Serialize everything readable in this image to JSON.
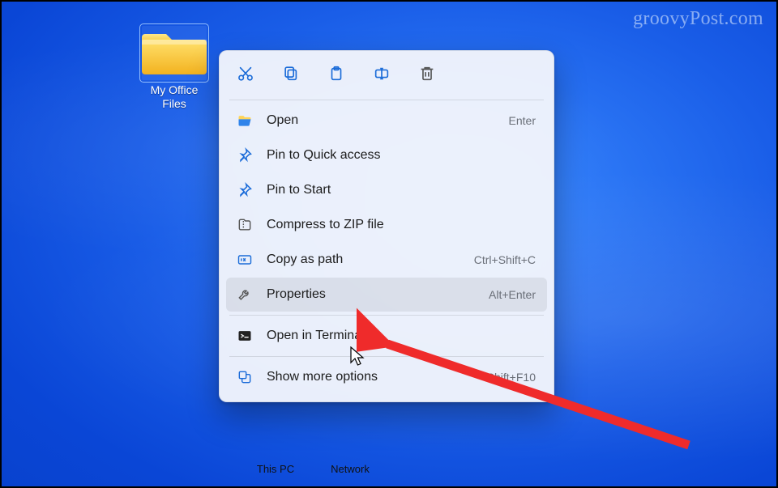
{
  "watermark": "groovyPost.com",
  "colors": {
    "icon": "#1a6bd8"
  },
  "desktop": {
    "folder": {
      "label": "My Office\nFiles"
    },
    "labels": {
      "thispc": "This PC",
      "network": "Network"
    }
  },
  "menu": {
    "toolbar": {
      "cut": "Cut",
      "copy": "Copy",
      "paste": "Paste",
      "rename": "Rename",
      "delete": "Delete"
    },
    "items": [
      {
        "label": "Open",
        "accel": "Enter"
      },
      {
        "label": "Pin to Quick access",
        "accel": ""
      },
      {
        "label": "Pin to Start",
        "accel": ""
      },
      {
        "label": "Compress to ZIP file",
        "accel": ""
      },
      {
        "label": "Copy as path",
        "accel": "Ctrl+Shift+C"
      },
      {
        "label": "Properties",
        "accel": "Alt+Enter"
      },
      {
        "label": "Open in Terminal",
        "accel": ""
      },
      {
        "label": "Show more options",
        "accel": "Shift+F10"
      }
    ]
  }
}
